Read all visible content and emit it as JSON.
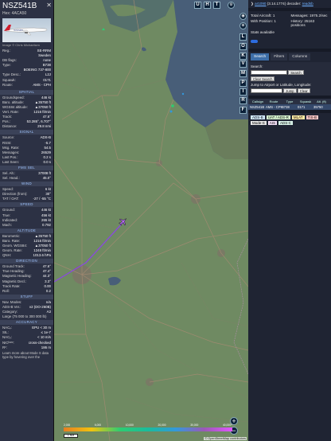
{
  "aircraft": {
    "callsign": "NSZ541B",
    "hex_label": "Hex: 4ACA50",
    "photo_credit": "Image © Chris Michaelsen",
    "reg_rows": [
      {
        "k": "Reg.:",
        "v": "SE-RRM"
      },
      {
        "k": "",
        "v": "Sweden"
      },
      {
        "k": "DB flags:",
        "v": "none"
      },
      {
        "k": "Type:",
        "v": "B738"
      },
      {
        "k": "",
        "v": "BOEING 737-800"
      },
      {
        "k": "Type Desc.:",
        "v": "L2J"
      },
      {
        "k": "Squawk:",
        "v": "0171"
      },
      {
        "k": "Route:",
        "v": "AMS - CPH"
      }
    ],
    "sections": [
      {
        "title": "SPATIAL",
        "rows": [
          {
            "k": "Groundspeed:",
            "v": "446 kt"
          },
          {
            "k": "Baro. altitude:",
            "v": "▲35750 ft"
          },
          {
            "k": "WGS84 altitude:",
            "v": "▲37050 ft"
          },
          {
            "k": "Vert. Rate:",
            "v": "1216 ft/min"
          },
          {
            "k": "Track:",
            "v": "47.6°"
          },
          {
            "k": "Pos.:",
            "v": "53.285°, 6.707°"
          },
          {
            "k": "Distance:",
            "v": "29.8 nmi"
          }
        ]
      },
      {
        "title": "SIGNAL",
        "rows": [
          {
            "k": "Source:",
            "v": "ADS-B"
          },
          {
            "k": "RSSI:",
            "v": "-5.7"
          },
          {
            "k": "Msg. Rate:",
            "v": "54.5"
          },
          {
            "k": "Messages:",
            "v": "26529"
          },
          {
            "k": "Last Pos.:",
            "v": "0.2 s"
          },
          {
            "k": "Last Seen:",
            "v": "0.0 s"
          }
        ]
      },
      {
        "title": "FMS SEL",
        "rows": [
          {
            "k": "Sel. Alt.:",
            "v": "37008 ft"
          },
          {
            "k": "Sel. Head.:",
            "v": "45.0°"
          }
        ]
      },
      {
        "title": "WIND",
        "rows": [
          {
            "k": "Speed:",
            "v": "6 kt"
          },
          {
            "k": "Direction (from):",
            "v": "30°"
          },
          {
            "k": "TAT / OAT:",
            "v": "-27 / -55 °C"
          }
        ]
      },
      {
        "title": "SPEED",
        "rows": [
          {
            "k": "Ground:",
            "v": "446 kt"
          },
          {
            "k": "True:",
            "v": "456 kt"
          },
          {
            "k": "Indicated:",
            "v": "265 kt"
          },
          {
            "k": "Mach:",
            "v": "0.792"
          }
        ]
      },
      {
        "title": "ALTITUDE",
        "rows": [
          {
            "k": "Barometric:",
            "v": "▲35750 ft"
          },
          {
            "k": "Baro. Rate:",
            "v": "1216 ft/min"
          },
          {
            "k": "Geom. WGS84:",
            "v": "▲37050 ft"
          },
          {
            "k": "Geom. Rate:",
            "v": "1248 ft/min"
          },
          {
            "k": "QNH:",
            "v": "1013.6 hPa"
          }
        ]
      },
      {
        "title": "DIRECTION",
        "rows": [
          {
            "k": "Ground Track:",
            "v": "47.6°"
          },
          {
            "k": "True Heading:",
            "v": "47.4°"
          },
          {
            "k": "Magnetic Heading:",
            "v": "44.3°"
          },
          {
            "k": "Magnetic Decl.:",
            "v": "3.3°"
          },
          {
            "k": "Track Rate:",
            "v": "0.00"
          },
          {
            "k": "Roll:",
            "v": "0.2"
          }
        ]
      },
      {
        "title": "STUFF",
        "rows": [
          {
            "k": "Nav. Modes:",
            "v": "n/a"
          },
          {
            "k": "ADS-B Ver.:",
            "v": "v2 (DO-260B)"
          },
          {
            "k": "Category:",
            "v": "A3"
          },
          {
            "k": "Large (75 000 to 300 000 lb)",
            "v": ""
          }
        ]
      },
      {
        "title": "ACCURACY",
        "rows": [
          {
            "k": "NACₚ:",
            "v": "EPU < 30 m"
          },
          {
            "k": "SIL:",
            "v": "≤ 1e-7"
          },
          {
            "k": "NACᵥ:",
            "v": "< 10 m/s"
          },
          {
            "k": "NICᵇᵃʳᵒ:",
            "v": "cross-checked"
          },
          {
            "k": "Rᶜ:",
            "v": "186 m"
          }
        ]
      }
    ],
    "footer_text": "Learn more about Mode S data type by hovering over the"
  },
  "map": {
    "top_buttons": [
      "U",
      "H",
      "T"
    ],
    "side_buttons": [
      "L",
      "O",
      "K",
      "V",
      "M",
      "P",
      "I",
      "R",
      "F"
    ],
    "scale_label": "1 NM",
    "attribution": "© OpenStreetMap contributors",
    "alt_ticks": [
      "2,000",
      "6,000",
      "10,000",
      "20,000",
      "30,000",
      "40,000+"
    ],
    "zoom_in": "+",
    "zoom_out": "−"
  },
  "right_panel": {
    "receiver_link": "ar1090",
    "version": "(3.14.1774)",
    "decoder_prefix": "decoder:",
    "decoder_link": "readsb",
    "stats": [
      {
        "k": "Total Aircraft:",
        "v": "1"
      },
      {
        "k": "Messages:",
        "v": "1975.2/sec"
      },
      {
        "k": "With Position:",
        "v": "1"
      },
      {
        "k": "History:",
        "v": "25163 positions"
      }
    ],
    "stats_available": "Stats available",
    "tabs": [
      "Search",
      "Filters",
      "Columns"
    ],
    "search_label": "Search:",
    "search_button": "Search",
    "clear_search": "Clear Search",
    "jump_label": "Jump to Airport or Latitude, Longitude:",
    "jump_button": "Jump",
    "clear_button": "Clear",
    "table_headers": [
      "Callsign",
      "Route",
      "Type",
      "Squawk",
      "Alt. (ft)"
    ],
    "table_row": [
      "NSZ541B",
      "AMS - CPH",
      "B738",
      "0171",
      "35750"
    ],
    "sources": [
      {
        "label": "ADS-B",
        "color": "#d4ecff"
      },
      {
        "label": "UAT / ADS-R",
        "color": "#d7f5d0"
      },
      {
        "label": "MLAT",
        "color": "#ffeaa5"
      },
      {
        "label": "TIS-B",
        "color": "#ffc9c9"
      },
      {
        "label": "Mode-S",
        "color": "#e6e6e6"
      },
      {
        "label": "AIS",
        "color": "#f3e0f7"
      },
      {
        "label": "ADS-C",
        "color": "#d9f3e9"
      }
    ]
  }
}
